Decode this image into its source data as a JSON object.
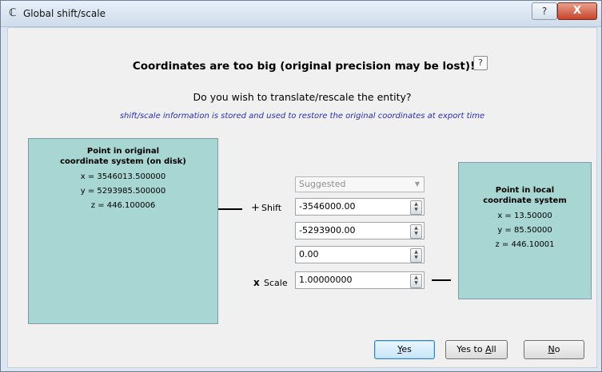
{
  "window": {
    "title": "Global shift/scale",
    "help_label": "?",
    "close_label": "X"
  },
  "dialog": {
    "heading": "Coordinates are too big (original precision may be lost)!",
    "heading_help": "?",
    "question": "Do you wish to translate/rescale the entity?",
    "info": "shift/scale information is stored and used to restore the original coordinates at export time"
  },
  "original_point": {
    "title_line1": "Point in original",
    "title_line2": "coordinate system (on disk)",
    "x": "x = 3546013.500000",
    "y": "y = 5293985.500000",
    "z": "z = 446.100006"
  },
  "local_point": {
    "title_line1": "Point in local",
    "title_line2": "coordinate system",
    "x": "x = 13.50000",
    "y": "y = 85.50000",
    "z": "z = 446.10001"
  },
  "transform": {
    "plus": "+",
    "shift_label": "Shift",
    "mult": "x",
    "scale_label": "Scale",
    "preset": "Suggested",
    "shift_x": "-3546000.00",
    "shift_y": "-5293900.00",
    "shift_z": "0.00",
    "scale": "1.00000000"
  },
  "buttons": {
    "yes_prefix": "",
    "yes_mnemonic": "Y",
    "yes_rest": "es",
    "yesall_prefix": "Yes to ",
    "yesall_mnemonic": "A",
    "yesall_rest": "ll",
    "no_prefix": "",
    "no_mnemonic": "N",
    "no_rest": "o"
  },
  "colors": {
    "point_box": "#a8d6d3",
    "info_text": "#2c2cb4"
  }
}
